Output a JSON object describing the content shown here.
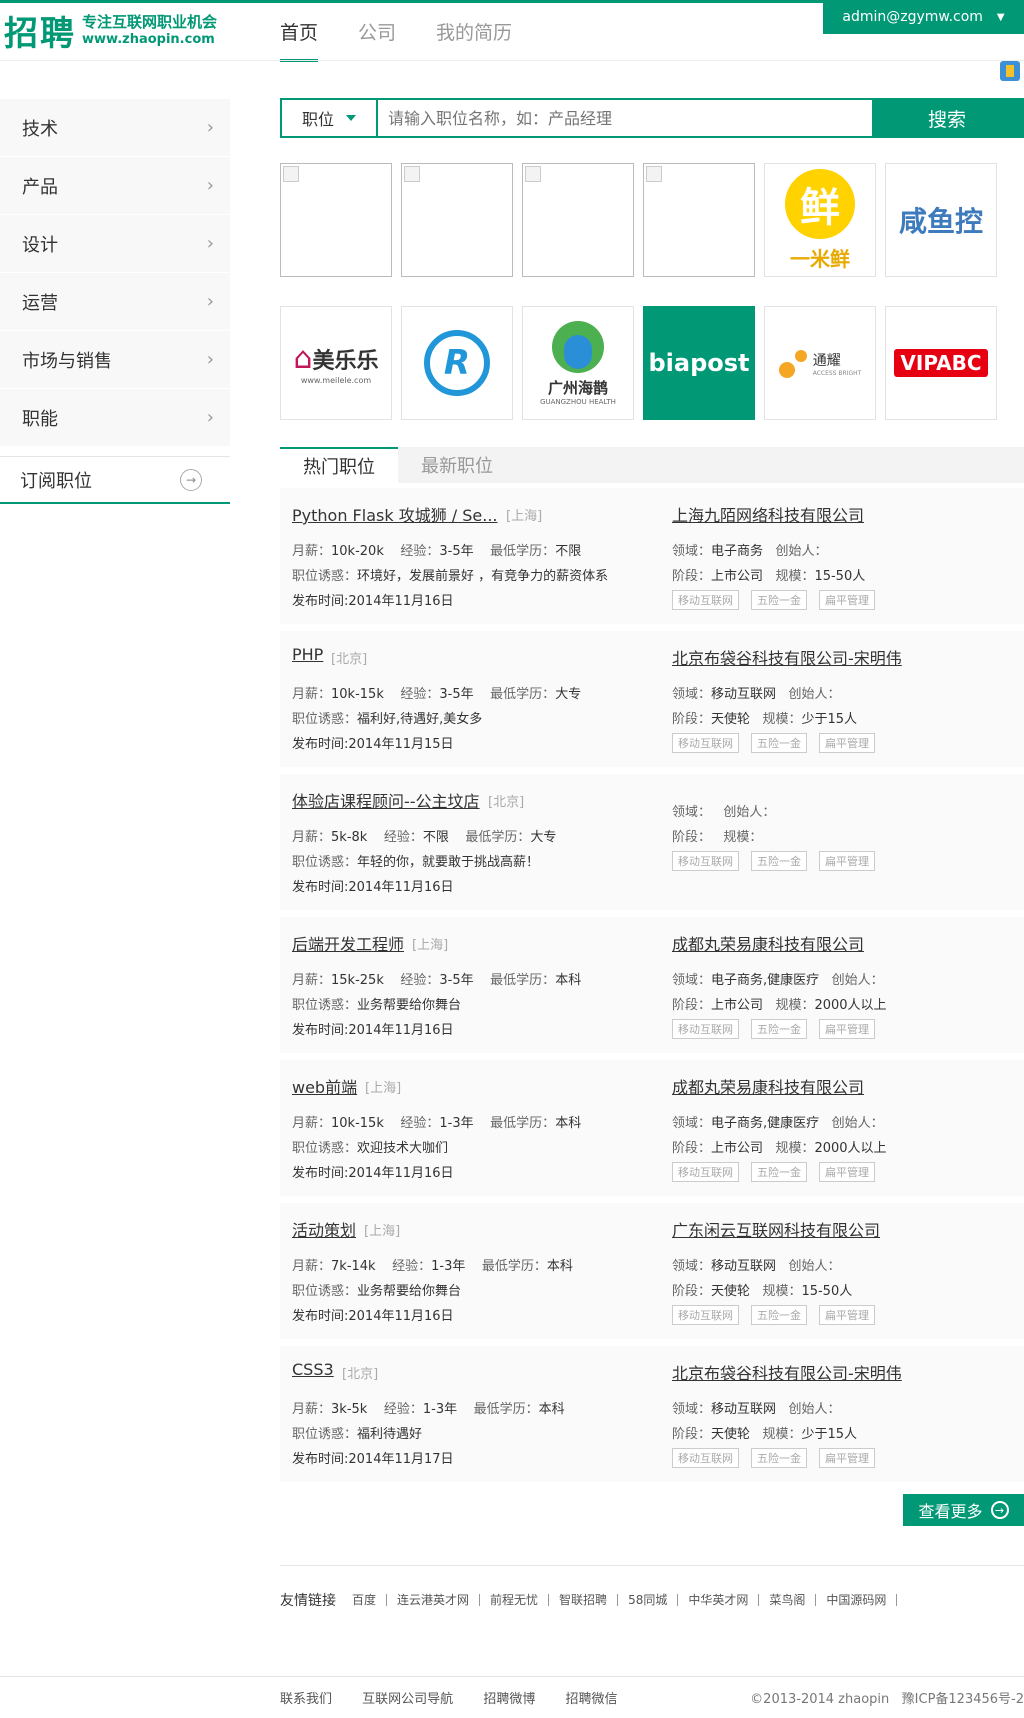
{
  "header": {
    "logo_big": "招聘",
    "logo_slogan": "专注互联网职业机会",
    "logo_url": "www.zhaopin.com",
    "nav": [
      {
        "label": "首页",
        "active": true
      },
      {
        "label": "公司",
        "active": false
      },
      {
        "label": "我的简历",
        "active": false
      }
    ],
    "user_email": "admin@zgymw.com",
    "accent": "#019875"
  },
  "sidebar": {
    "items": [
      {
        "label": "技术"
      },
      {
        "label": "产品"
      },
      {
        "label": "设计"
      },
      {
        "label": "运营"
      },
      {
        "label": "市场与销售"
      },
      {
        "label": "职能"
      }
    ],
    "subscribe_label": "订阅职位"
  },
  "search": {
    "type_label": "职位",
    "placeholder": "请输入职位名称，如：产品经理",
    "button_label": "搜索"
  },
  "logos": {
    "row1": [
      "",
      "",
      "",
      "",
      "一米鲜",
      "咸鱼控"
    ],
    "row2": [
      "美乐乐",
      "R",
      "广州海鹊",
      "biapost",
      "通耀",
      "VIPABC"
    ],
    "sub_text": {
      "meilele": "www.meilele.com",
      "guangzhou": "GUANGZHOU HEALTH",
      "tongyao": "ACCESS BRIGHT",
      "yimixian_char": "鲜"
    }
  },
  "tabs": [
    {
      "label": "热门职位",
      "active": true
    },
    {
      "label": "最新职位",
      "active": false
    }
  ],
  "labels": {
    "salary": "月薪：",
    "experience": "经验：",
    "education": "最低学历：",
    "allure": "职位诱惑：",
    "posted": "发布时间:",
    "field": "领域：",
    "founder": "创始人：",
    "stage": "阶段：",
    "scale": "规模："
  },
  "jobs": [
    {
      "title": "Python Flask 攻城狮 / Se...",
      "city": "[上海]",
      "salary": "10k-20k",
      "experience": "3-5年",
      "education": "不限",
      "allure": "环境好，发展前景好 ，有竞争力的薪资体系",
      "posted": "2014年11月16日",
      "company": "上海九陌网络科技有限公司",
      "field": "电子商务",
      "stage": "上市公司",
      "scale": "15-50人",
      "tags": [
        "移动互联网",
        "五险一金",
        "扁平管理"
      ]
    },
    {
      "title": "PHP",
      "city": "[北京]",
      "salary": "10k-15k",
      "experience": "3-5年",
      "education": "大专",
      "allure": "福利好,待遇好,美女多",
      "posted": "2014年11月15日",
      "company": "北京布袋谷科技有限公司-宋明伟",
      "field": "移动互联网",
      "stage": "天使轮",
      "scale": "少于15人",
      "tags": [
        "移动互联网",
        "五险一金",
        "扁平管理"
      ]
    },
    {
      "title": "体验店课程顾问--公主坟店",
      "city": "[北京]",
      "salary": "5k-8k",
      "experience": "不限",
      "education": "大专",
      "allure": "年轻的你，就要敢于挑战高薪！",
      "posted": "2014年11月16日",
      "company": "",
      "field": "",
      "stage": "",
      "scale": "",
      "tags": [
        "移动互联网",
        "五险一金",
        "扁平管理"
      ]
    },
    {
      "title": "后端开发工程师",
      "city": "[上海]",
      "salary": "15k-25k",
      "experience": "3-5年",
      "education": "本科",
      "allure": "业务帮要给你舞台",
      "posted": "2014年11月16日",
      "company": "成都丸荣易康科技有限公司",
      "field": "电子商务,健康医疗",
      "stage": "上市公司",
      "scale": "2000人以上",
      "tags": [
        "移动互联网",
        "五险一金",
        "扁平管理"
      ]
    },
    {
      "title": "web前端",
      "city": "[上海]",
      "salary": "10k-15k",
      "experience": "1-3年",
      "education": "本科",
      "allure": "欢迎技术大咖们",
      "posted": "2014年11月16日",
      "company": "成都丸荣易康科技有限公司",
      "field": "电子商务,健康医疗",
      "stage": "上市公司",
      "scale": "2000人以上",
      "tags": [
        "移动互联网",
        "五险一金",
        "扁平管理"
      ]
    },
    {
      "title": "活动策划",
      "city": "[上海]",
      "salary": "7k-14k",
      "experience": "1-3年",
      "education": "本科",
      "allure": "业务帮要给你舞台",
      "posted": "2014年11月16日",
      "company": "广东闲云互联网科技有限公司",
      "field": "移动互联网",
      "stage": "天使轮",
      "scale": "15-50人",
      "tags": [
        "移动互联网",
        "五险一金",
        "扁平管理"
      ]
    },
    {
      "title": "CSS3",
      "city": "[北京]",
      "salary": "3k-5k",
      "experience": "1-3年",
      "education": "本科",
      "allure": "福利待遇好",
      "posted": "2014年11月17日",
      "company": "北京布袋谷科技有限公司-宋明伟",
      "field": "移动互联网",
      "stage": "天使轮",
      "scale": "少于15人",
      "tags": [
        "移动互联网",
        "五险一金",
        "扁平管理"
      ]
    }
  ],
  "more_label": "查看更多",
  "friend_links": {
    "heading": "友情链接",
    "links": [
      "百度",
      "连云港英才网",
      "前程无忧",
      "智联招聘",
      "58同城",
      "中华英才网",
      "菜鸟阁",
      "中国源码网"
    ]
  },
  "footer": {
    "links": [
      "联系我们",
      "互联网公司导航",
      "招聘微博",
      "招聘微信"
    ],
    "copyright": "©2013-2014 zhaopin",
    "icp": "豫ICP备123456号-2"
  }
}
